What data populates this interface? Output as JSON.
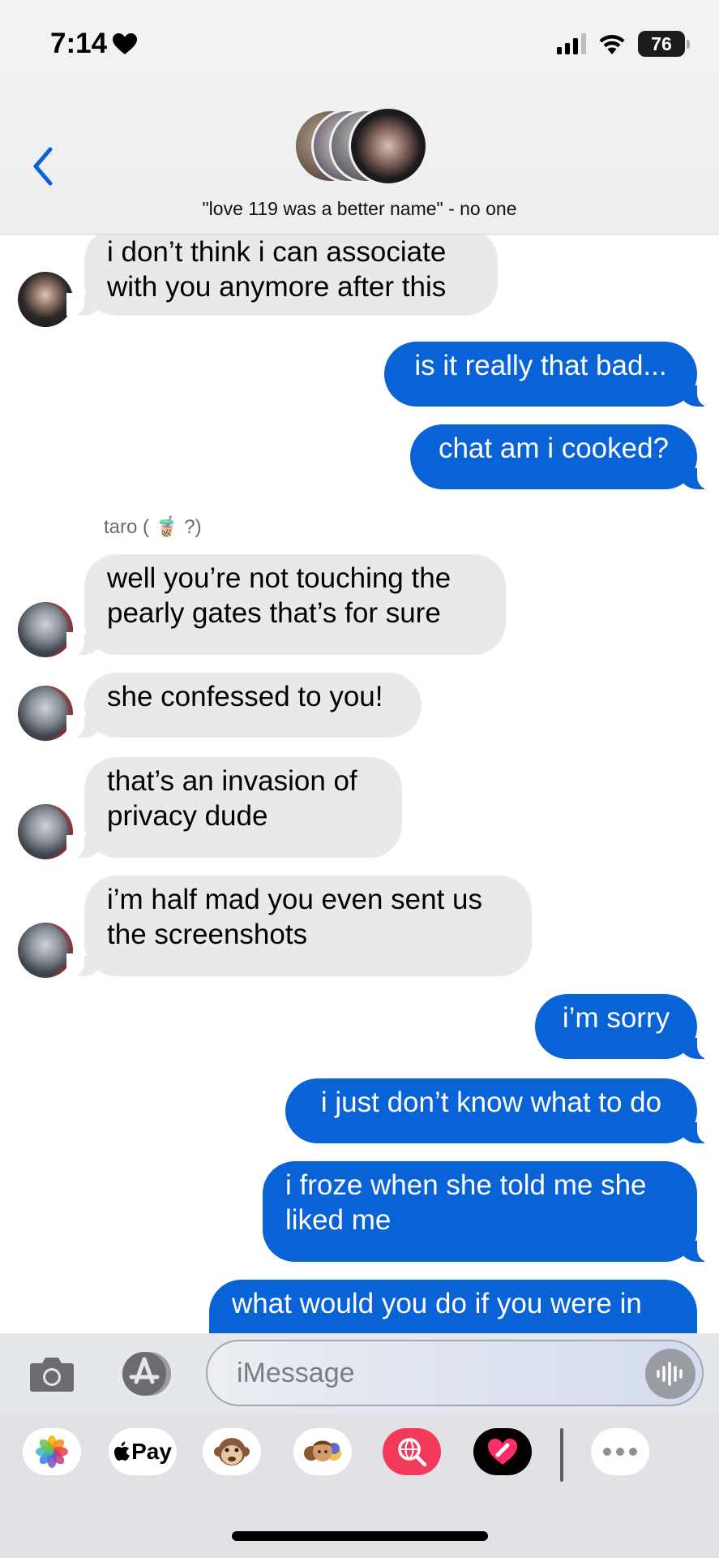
{
  "status_bar": {
    "time": "7:14",
    "battery": "76"
  },
  "header": {
    "conversation_name": "\"love 119 was a better name\" - no one"
  },
  "messages": [
    {
      "text": "i don’t think i can associate\nwith you anymore after this"
    },
    {
      "text": "is it really that bad..."
    },
    {
      "text": "chat am i cooked?"
    },
    {
      "sender": "taro ( 🧋 ?)"
    },
    {
      "text": "well you’re not touching the\npearly gates that’s for sure"
    },
    {
      "text": "she confessed to you!"
    },
    {
      "text": "that’s an invasion of\nprivacy dude"
    },
    {
      "text": "i’m half mad you even sent us\nthe screenshots"
    },
    {
      "text": "i’m sorry"
    },
    {
      "text": "i just don’t know what to do"
    },
    {
      "text": "i froze when she told me she\nliked me"
    },
    {
      "text": "what would you do if you were in"
    }
  ],
  "input": {
    "placeholder": "iMessage"
  },
  "app_drawer": {
    "apple_pay_label": "Pay"
  },
  "colors": {
    "outgoing_bubble": "#0a63d6",
    "incoming_bubble": "#e9e9eb",
    "accent": "#0a63d6"
  }
}
